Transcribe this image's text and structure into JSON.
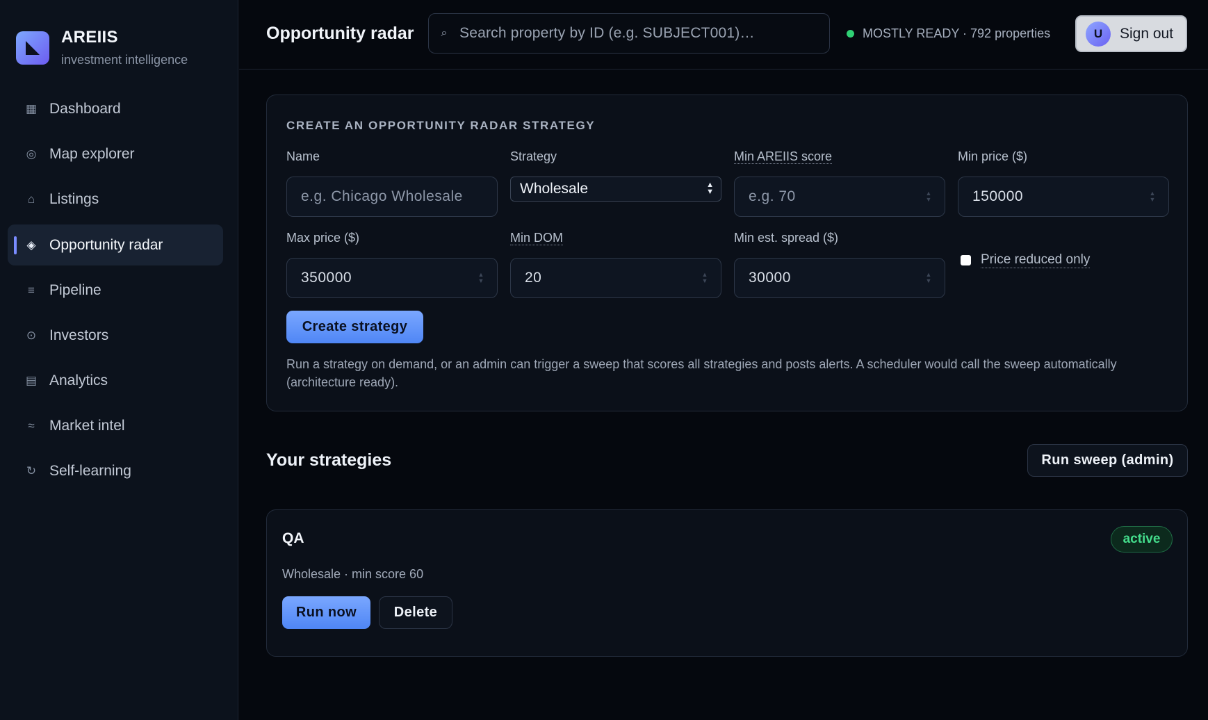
{
  "brand": {
    "name": "AREIIS",
    "tagline": "investment intelligence"
  },
  "sidebar": {
    "items": [
      {
        "label": "Dashboard",
        "icon": "dashboard-icon",
        "glyph": "▦"
      },
      {
        "label": "Map explorer",
        "icon": "map-icon",
        "glyph": "◎"
      },
      {
        "label": "Listings",
        "icon": "home-icon",
        "glyph": "⌂"
      },
      {
        "label": "Opportunity radar",
        "icon": "radar-icon",
        "glyph": "◈",
        "active": true
      },
      {
        "label": "Pipeline",
        "icon": "pipeline-icon",
        "glyph": "≡"
      },
      {
        "label": "Investors",
        "icon": "investors-icon",
        "glyph": "⊙"
      },
      {
        "label": "Analytics",
        "icon": "analytics-icon",
        "glyph": "▤"
      },
      {
        "label": "Market intel",
        "icon": "market-icon",
        "glyph": "≈"
      },
      {
        "label": "Self-learning",
        "icon": "refresh-icon",
        "glyph": "↻"
      }
    ]
  },
  "header": {
    "title": "Opportunity radar",
    "search_placeholder": "Search property by ID (e.g. SUBJECT001)…",
    "status_text": "MOSTLY READY · 792 properties",
    "status_color": "#2fd074",
    "avatar_initial": "U",
    "signout_label": "Sign out"
  },
  "create_form": {
    "heading": "CREATE AN OPPORTUNITY RADAR STRATEGY",
    "name": {
      "label": "Name",
      "placeholder": "e.g. Chicago Wholesale",
      "value": ""
    },
    "strategy": {
      "label": "Strategy",
      "value": "Wholesale"
    },
    "min_score": {
      "label": "Min AREIIS score",
      "placeholder": "e.g. 70",
      "value": ""
    },
    "min_price": {
      "label": "Min price ($)",
      "value": "150000"
    },
    "max_price": {
      "label": "Max price ($)",
      "value": "350000"
    },
    "min_dom": {
      "label": "Min DOM",
      "value": "20"
    },
    "min_spread": {
      "label": "Min est. spread ($)",
      "value": "30000"
    },
    "price_reduced": {
      "label": "Price reduced only",
      "checked": false
    },
    "submit_label": "Create strategy",
    "help_text": "Run a strategy on demand, or an admin can trigger a sweep that scores all strategies and posts alerts. A scheduler would call the sweep automatically (architecture ready)."
  },
  "strategies": {
    "title": "Your strategies",
    "sweep_label": "Run sweep (admin)",
    "items": [
      {
        "name": "QA",
        "status": "active",
        "meta": "Wholesale · min score 60",
        "run_label": "Run now",
        "delete_label": "Delete"
      }
    ]
  },
  "colors": {
    "accent": "#5b8cf7",
    "active_badge": "#44dd8c",
    "background": "#05080e",
    "sidebar": "#0c121c"
  }
}
